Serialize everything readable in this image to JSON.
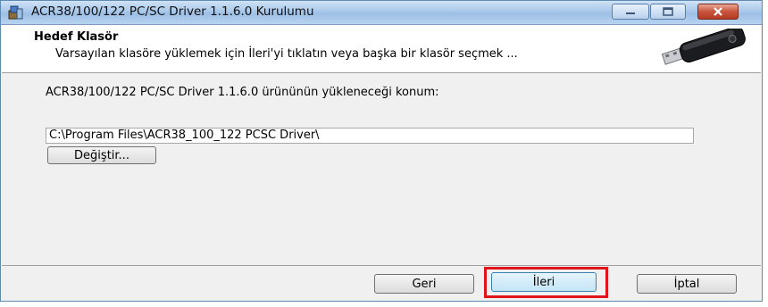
{
  "window": {
    "title": "ACR38/100/122 PC/SC Driver 1.1.6.0 Kurulumu",
    "controls": {
      "minimize": "—",
      "maximize": "□",
      "close": "✕"
    }
  },
  "header": {
    "title": "Hedef Klasör",
    "subtitle": "Varsayılan klasöre yüklemek için İleri'yi tıklatın veya başka bir klasör seçmek ...",
    "graphic": "usb-token-reader-icon"
  },
  "content": {
    "location_label": "ACR38/100/122 PC/SC Driver 1.1.6.0 ürününün yükleneceği konum:",
    "install_path": "C:\\Program Files\\ACR38_100_122 PCSC Driver\\",
    "change_button": "Değiştir..."
  },
  "footer": {
    "back_button": "Geri",
    "next_button": "İleri",
    "cancel_button": "İptal"
  },
  "colors": {
    "highlight": "#e0141b",
    "titlebar": "#a9c8ea",
    "close_button": "#c9543d"
  }
}
